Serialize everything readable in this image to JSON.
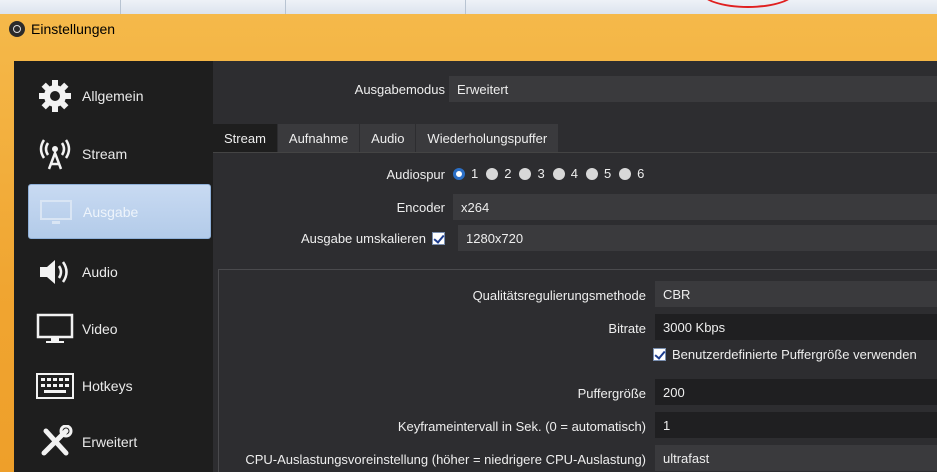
{
  "window": {
    "title": "Einstellungen"
  },
  "sidebar": {
    "items": [
      {
        "label": "Allgemein",
        "icon": "gear-icon"
      },
      {
        "label": "Stream",
        "icon": "broadcast-icon"
      },
      {
        "label": "Ausgabe",
        "icon": "output-icon",
        "active": true
      },
      {
        "label": "Audio",
        "icon": "speaker-icon"
      },
      {
        "label": "Video",
        "icon": "monitor-icon"
      },
      {
        "label": "Hotkeys",
        "icon": "keyboard-icon"
      },
      {
        "label": "Erweitert",
        "icon": "tools-icon"
      }
    ]
  },
  "output": {
    "mode_label": "Ausgabemodus",
    "mode_value": "Erweitert",
    "tabs": [
      "Stream",
      "Aufnahme",
      "Audio",
      "Wiederholungspuffer"
    ],
    "audiotrack_label": "Audiospur",
    "audiotracks": [
      "1",
      "2",
      "3",
      "4",
      "5",
      "6"
    ],
    "audiotrack_selected": "1",
    "encoder_label": "Encoder",
    "encoder_value": "x264",
    "rescale_label": "Ausgabe umskalieren",
    "rescale_checked": true,
    "rescale_value": "1280x720",
    "rate_control_label": "Qualitätsregulierungsmethode",
    "rate_control_value": "CBR",
    "bitrate_label": "Bitrate",
    "bitrate_value": "3000 Kbps",
    "custom_buffer_label": "Benutzerdefinierte Puffergröße verwenden",
    "custom_buffer_checked": true,
    "buffer_label": "Puffergröße",
    "buffer_value": "200",
    "keyframe_label": "Keyframeintervall in Sek. (0 = automatisch)",
    "keyframe_value": "1",
    "cpu_preset_label": "CPU-Auslastungsvoreinstellung (höher = niedrigere CPU-Auslastung)",
    "cpu_preset_value": "ultrafast"
  },
  "colors": {
    "accent": "#2b6fc6",
    "frame": "#f0a531",
    "panel": "#2d2d30",
    "sidebar": "#1e1e1e"
  }
}
